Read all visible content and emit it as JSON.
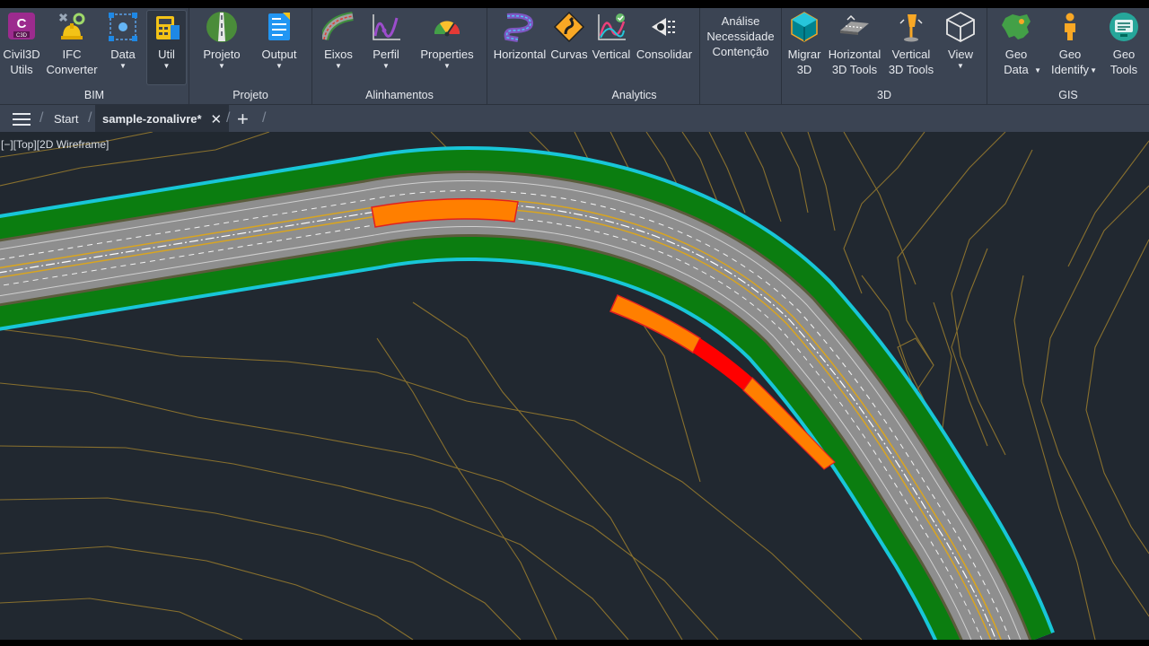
{
  "ribbon": {
    "groups": {
      "bim": {
        "label": "BIM",
        "buttons": [
          {
            "label": "Civil3D\nUtils"
          },
          {
            "label": "IFC\nConverter"
          },
          {
            "label": "Data"
          },
          {
            "label": "Util"
          }
        ]
      },
      "projeto": {
        "label": "Projeto",
        "buttons": [
          {
            "label": "Projeto"
          },
          {
            "label": "Output"
          }
        ]
      },
      "alinhamentos": {
        "label": "Alinhamentos",
        "buttons": [
          {
            "label": "Eixos"
          },
          {
            "label": "Perfil"
          },
          {
            "label": "Properties"
          }
        ]
      },
      "analytics": {
        "label": "Analytics",
        "buttons": [
          {
            "label": "Horizontal"
          },
          {
            "label": "Curvas"
          },
          {
            "label": "Vertical"
          },
          {
            "label": "Consolidar"
          },
          {
            "label": "Análise\nNecessidade\nContenção"
          }
        ]
      },
      "three_d": {
        "label": "3D",
        "buttons": [
          {
            "label": "Migrar\n3D"
          },
          {
            "label": "Horizontal\n3D Tools"
          },
          {
            "label": "Vertical\n3D Tools"
          },
          {
            "label": "View"
          }
        ]
      },
      "gis": {
        "label": "GIS",
        "buttons": [
          {
            "label": "Geo\nData"
          },
          {
            "label": "Geo\nIdentify"
          },
          {
            "label": "Geo\nTools"
          }
        ]
      }
    }
  },
  "tabs": {
    "start": "Start",
    "document": "sample-zonalivre*"
  },
  "viewport": {
    "label": "[−][Top][2D Wireframe]"
  },
  "colors": {
    "ribbon_bg": "#3b4453",
    "canvas_bg": "#212830",
    "contour": "#9b7d2e",
    "road_edge": "#18c6d8",
    "shoulder": "#0b7d10",
    "pavement": "#8e8e8e",
    "centerline": "#d9a520",
    "warning": "#ff7f00",
    "critical": "#ff0000"
  }
}
